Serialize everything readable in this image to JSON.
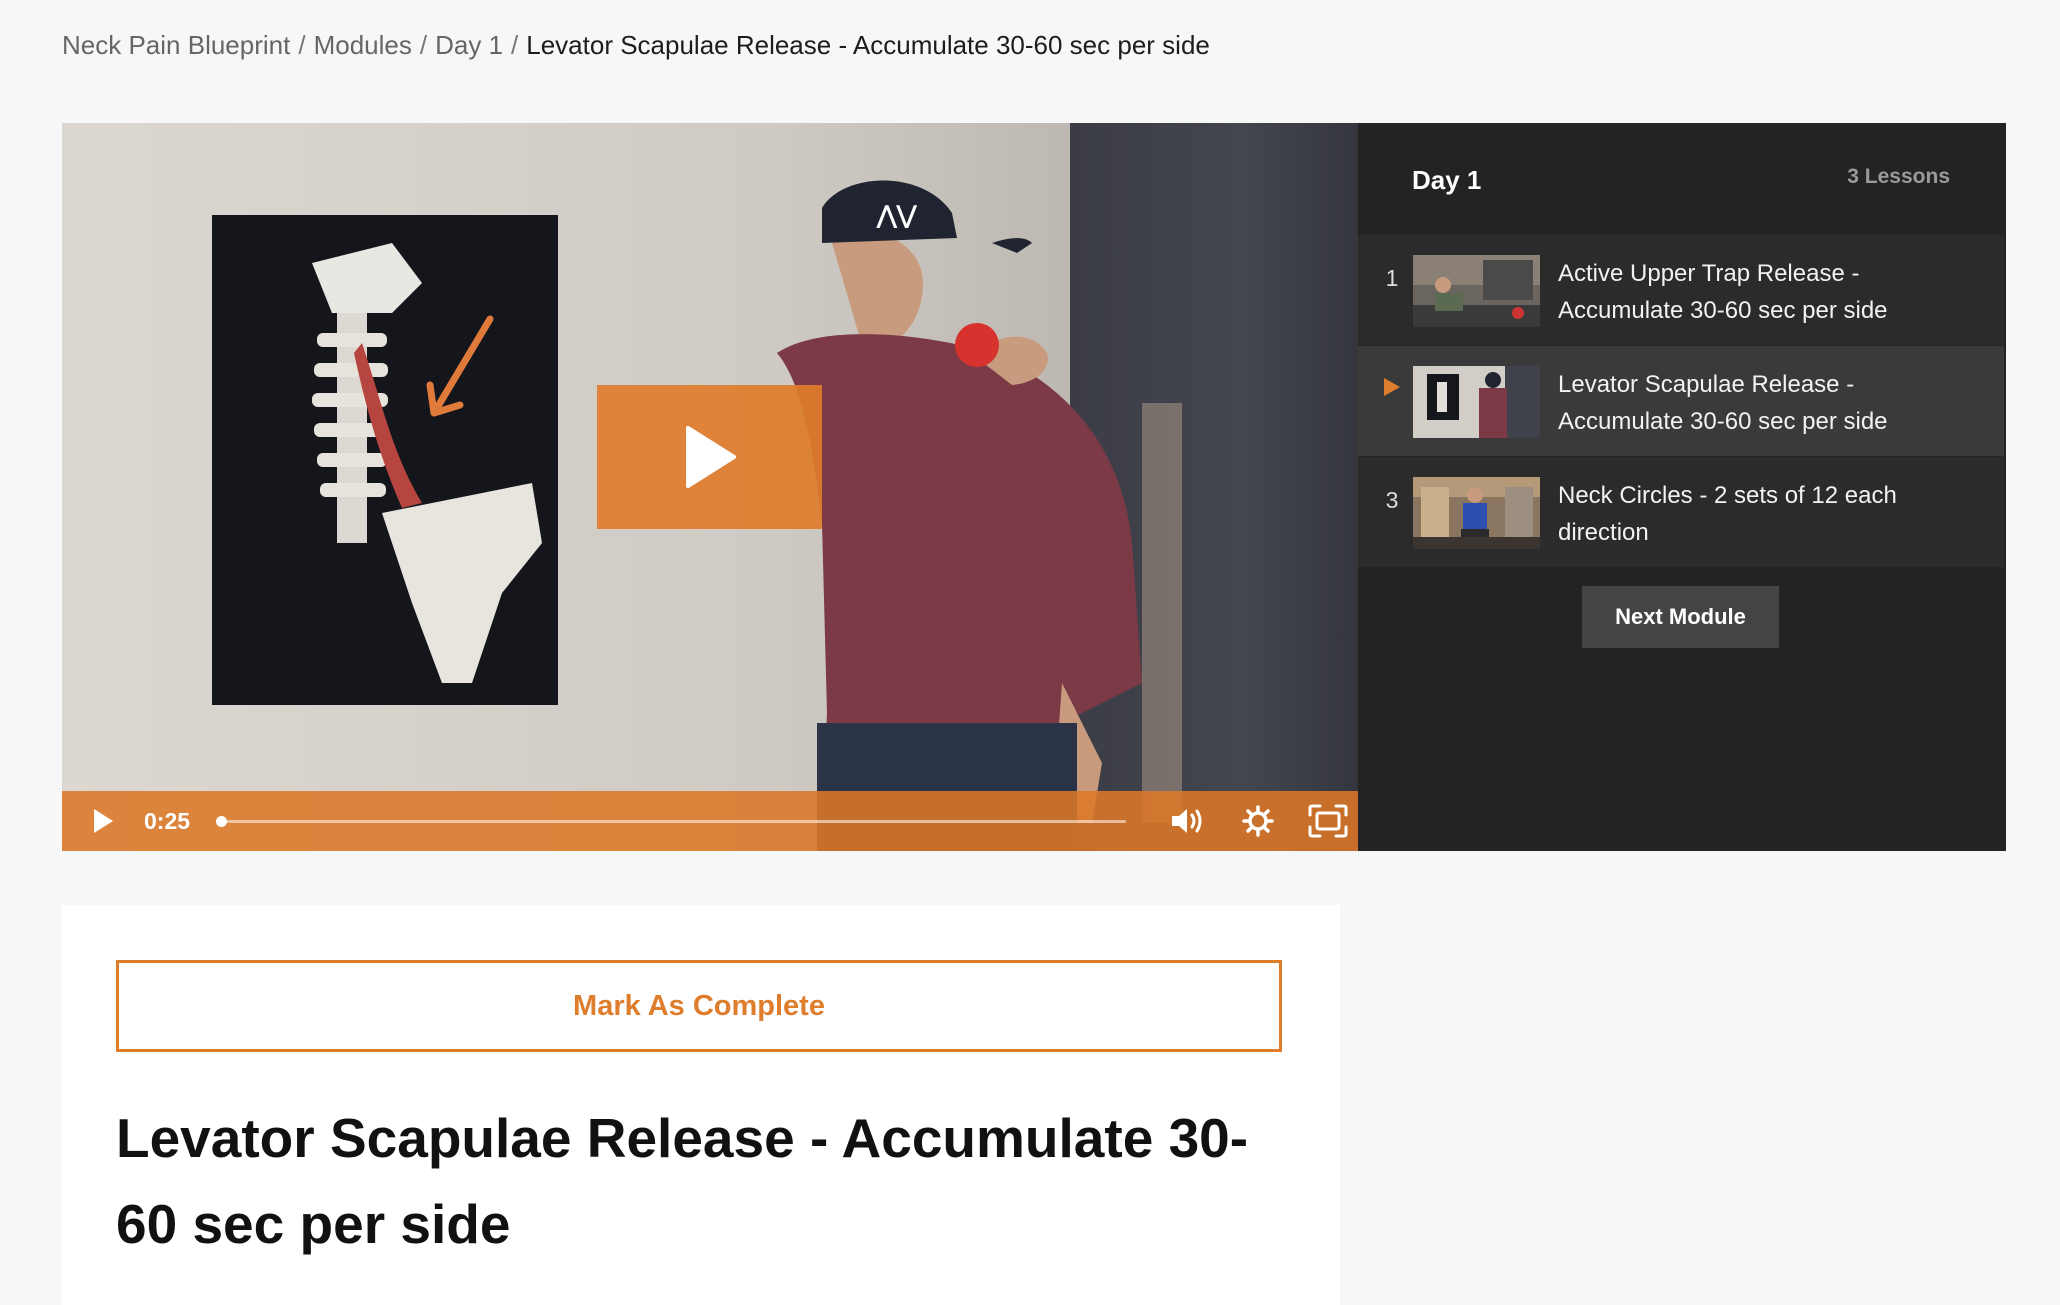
{
  "breadcrumb": {
    "items": [
      "Neck Pain Blueprint",
      "Modules",
      "Day 1"
    ],
    "separator": "/",
    "current": "Levator Scapulae Release - Accumulate 30-60 sec per side"
  },
  "video": {
    "current_time": "0:25",
    "progress_fraction": 0.0,
    "accent_color": "#de7d2c",
    "icons": [
      "play-icon",
      "volume-icon",
      "settings-icon",
      "fullscreen-icon"
    ]
  },
  "playlist": {
    "title": "Day 1",
    "count_label": "3 Lessons",
    "lessons": [
      {
        "number": "1",
        "title": "Active Upper Trap Release - Accumulate 30-60 sec per side",
        "active": false
      },
      {
        "number": "",
        "title": "Levator Scapulae Release - Accumulate 30-60 sec per side",
        "active": true
      },
      {
        "number": "3",
        "title": "Neck Circles - 2 sets of 12 each direction",
        "active": false
      }
    ],
    "next_label": "Next Module"
  },
  "main": {
    "complete_label": "Mark As Complete",
    "lesson_title": "Levator Scapulae Release - Accumulate 30-60 sec per side"
  }
}
